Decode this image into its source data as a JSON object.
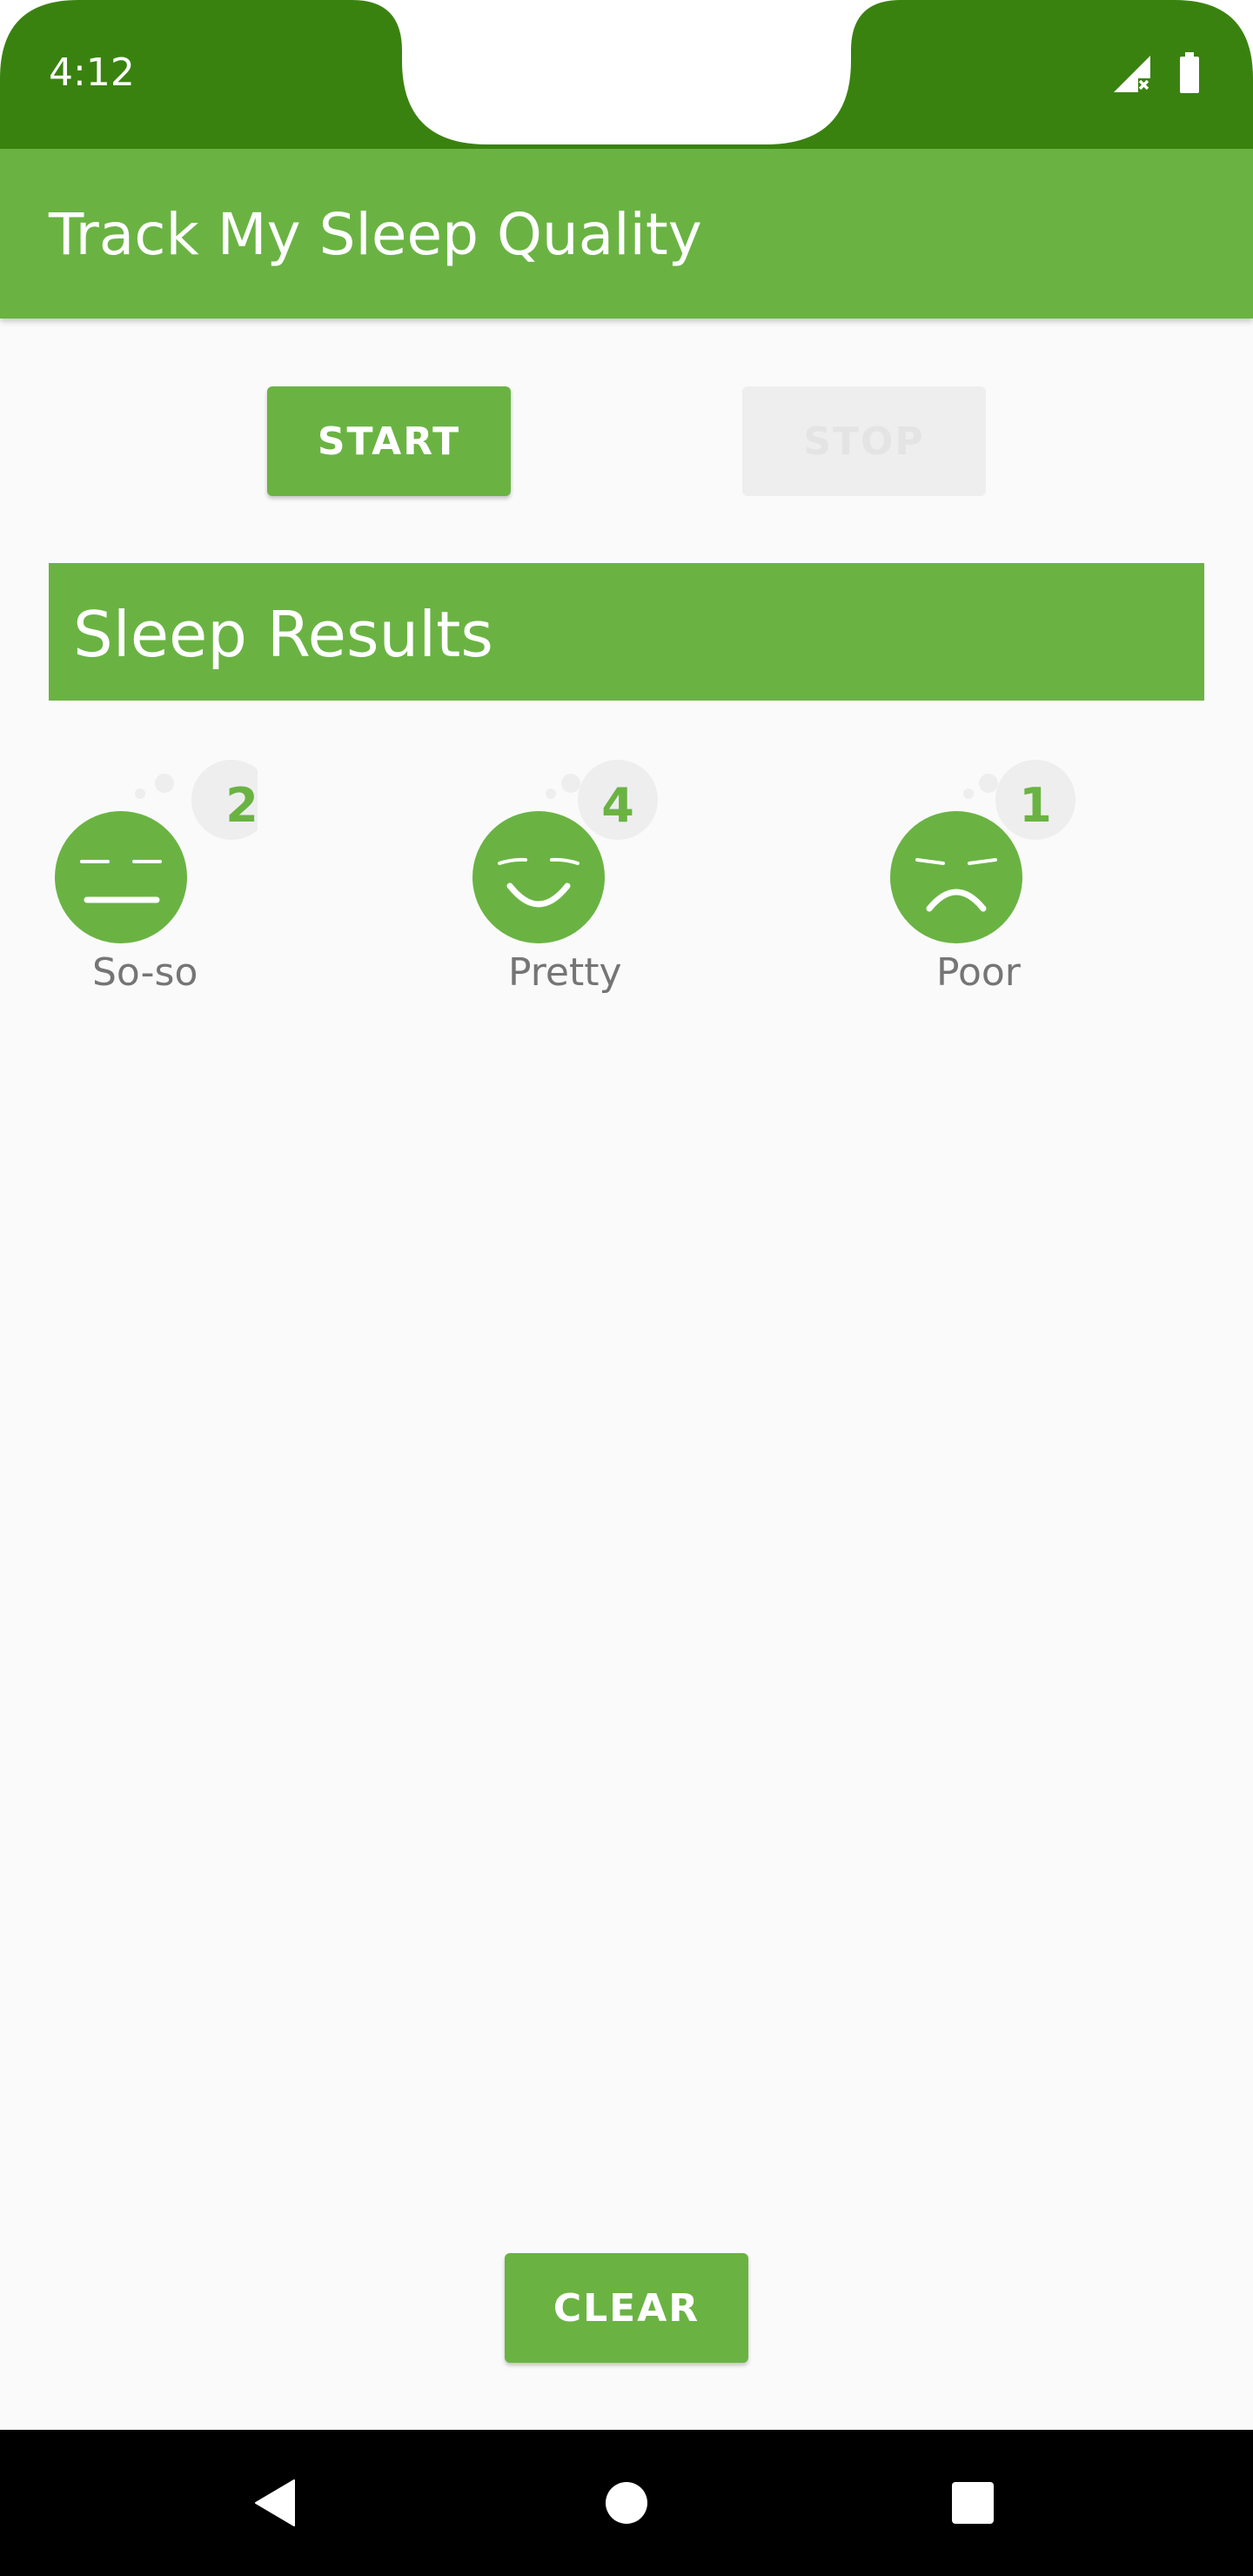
{
  "status_bar": {
    "time": "4:12",
    "icons": [
      "signal-no-data-icon",
      "battery-icon"
    ]
  },
  "app_bar": {
    "title": "Track My Sleep Quality"
  },
  "controls": {
    "start_label": "START",
    "stop_label": "STOP"
  },
  "results": {
    "title": "Sleep Results",
    "items": [
      {
        "count": "2",
        "label": "So-so",
        "icon": "so-so-face-icon"
      },
      {
        "count": "4",
        "label": "Pretty",
        "icon": "pretty-good-face-icon"
      },
      {
        "count": "1",
        "label": "Poor",
        "icon": "poor-face-icon"
      }
    ]
  },
  "footer": {
    "clear_label": "CLEAR"
  },
  "nav_bar": {
    "buttons": [
      "back-icon",
      "home-icon",
      "recents-icon"
    ]
  },
  "colors": {
    "primary": "#6ab343",
    "primary_dark": "#3a8210",
    "background": "#fafafa",
    "label_text": "#757575",
    "disabled_button": "#eeeeee"
  }
}
